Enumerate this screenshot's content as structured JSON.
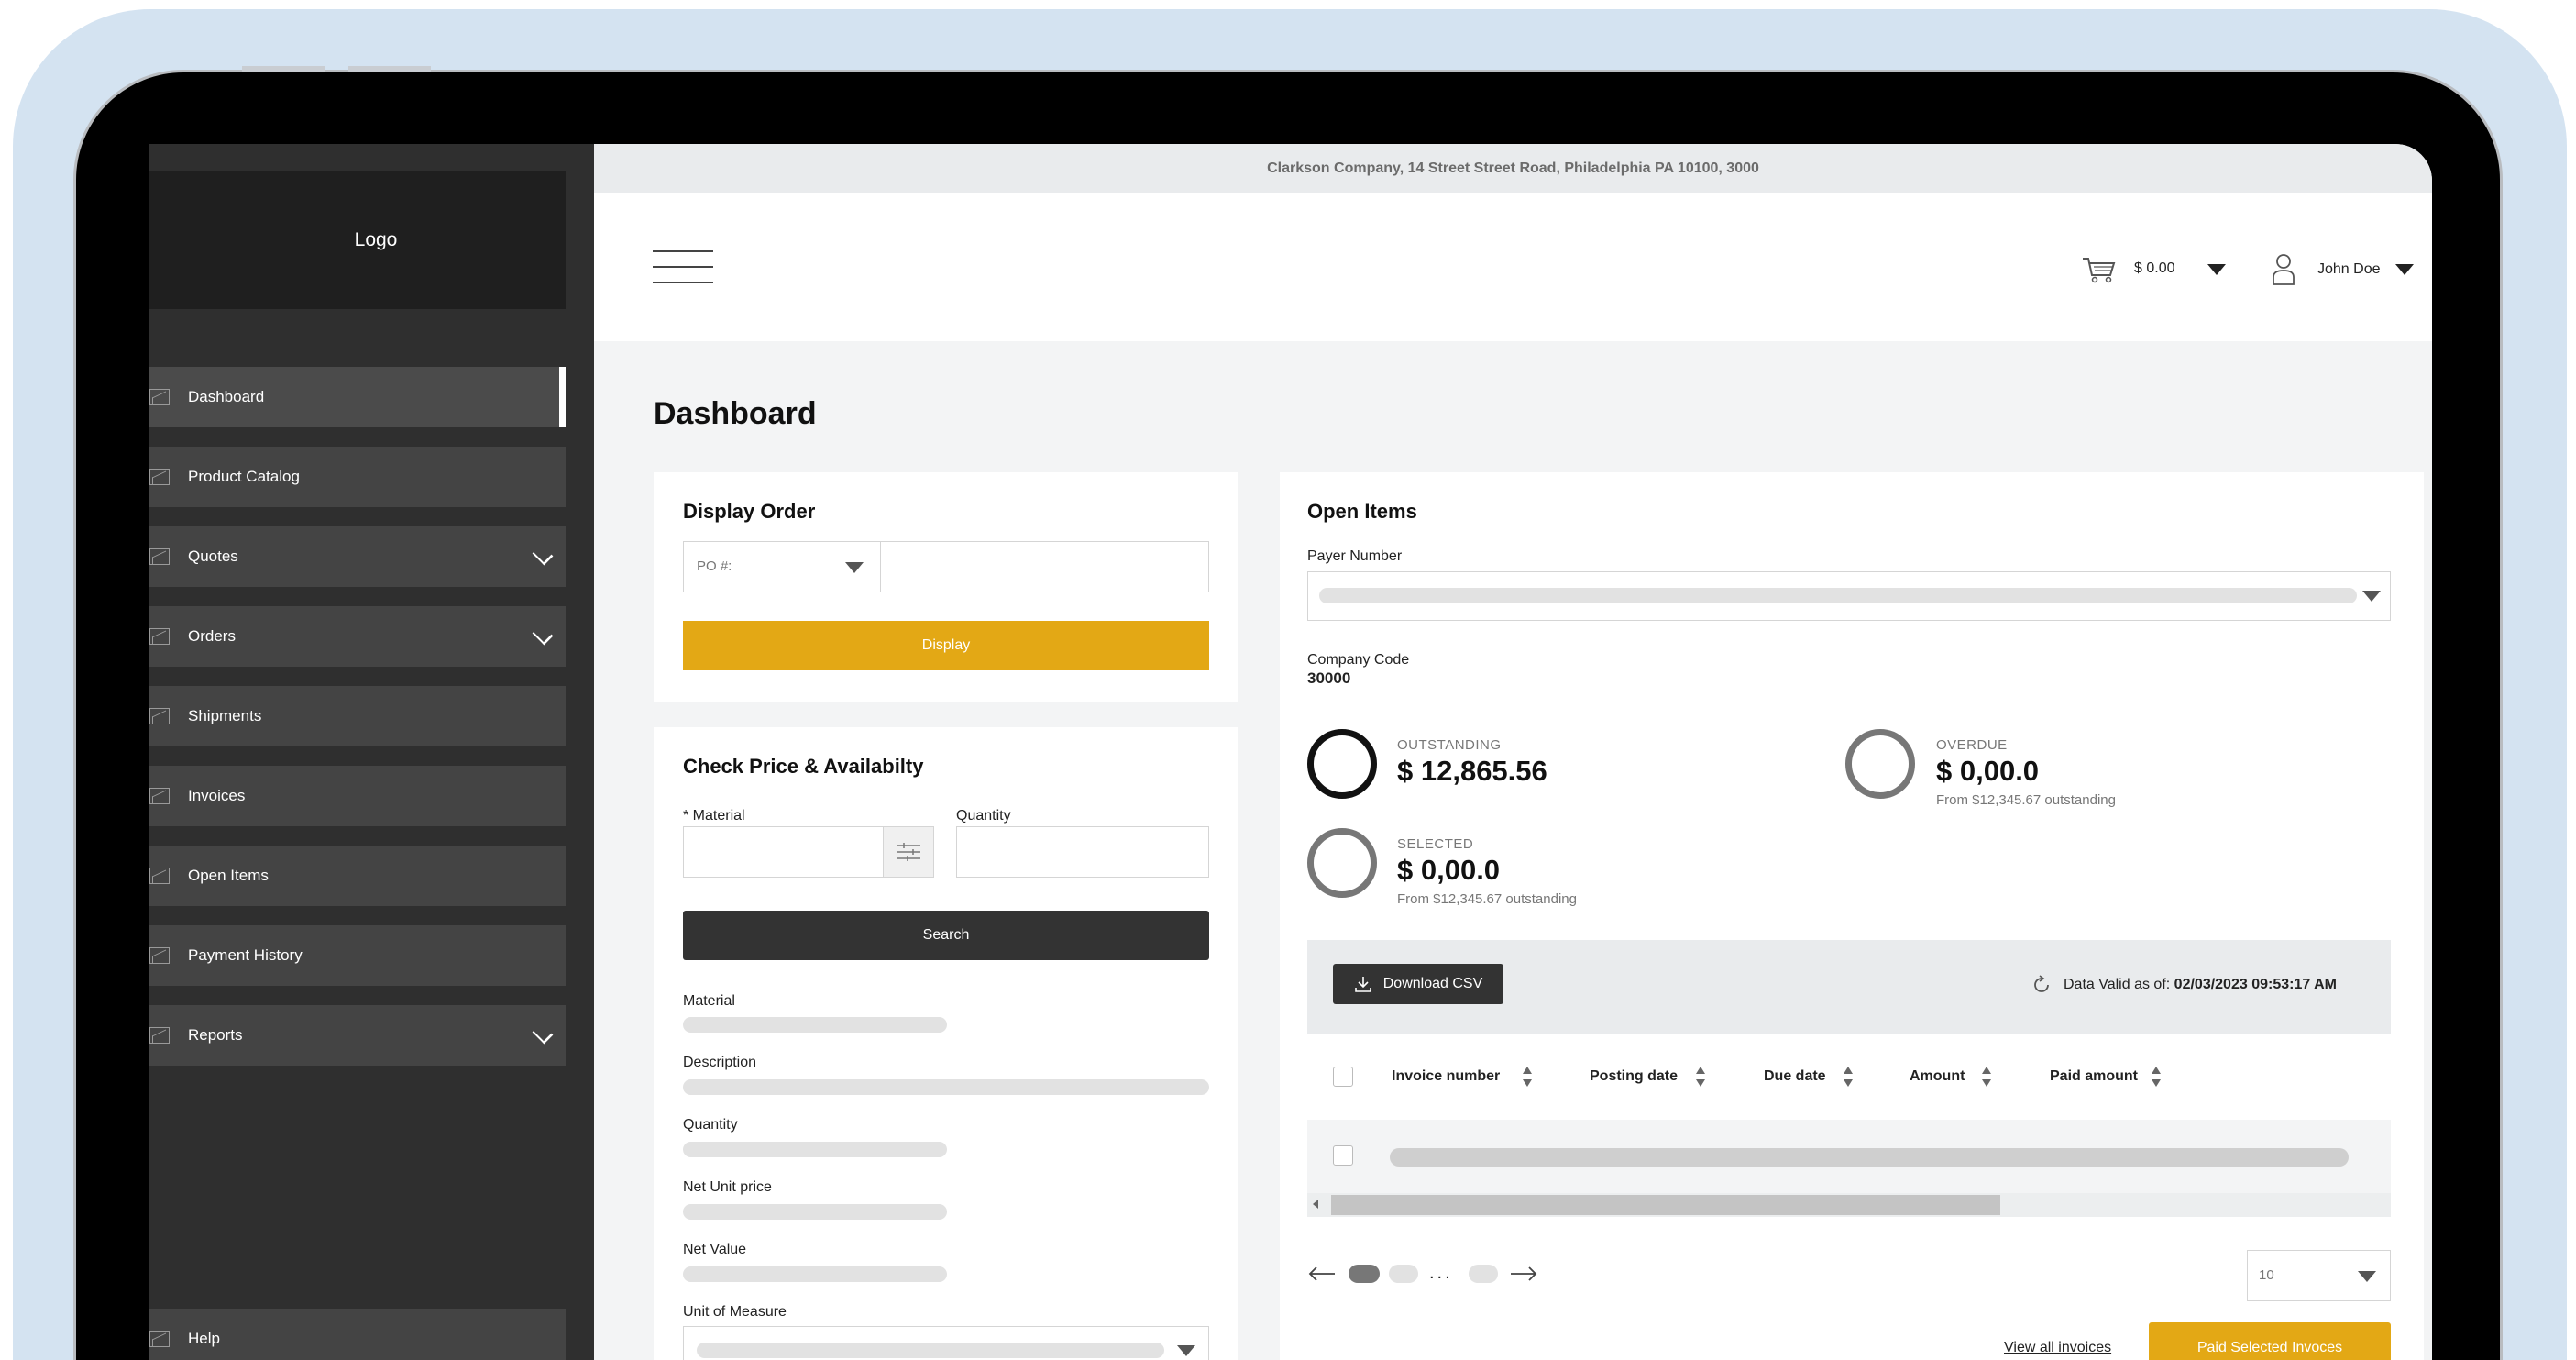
{
  "sidebar": {
    "logo": "Logo",
    "items": [
      {
        "label": "Dashboard",
        "active": true,
        "expandable": false
      },
      {
        "label": "Product Catalog",
        "expandable": false
      },
      {
        "label": "Quotes",
        "expandable": true
      },
      {
        "label": "Orders",
        "expandable": true
      },
      {
        "label": "Shipments",
        "expandable": false
      },
      {
        "label": "Invoices",
        "expandable": false
      },
      {
        "label": "Open Items",
        "expandable": false
      },
      {
        "label": "Payment History",
        "expandable": false
      },
      {
        "label": "Reports",
        "expandable": true
      }
    ],
    "help": "Help"
  },
  "topbar": {
    "address": "Clarkson Company, 14 Street Street Road, Philadelphia PA 10100, 3000"
  },
  "header": {
    "cart_amount": "$ 0.00",
    "user_name": "John Doe"
  },
  "main": {
    "title": "Dashboard"
  },
  "display_order": {
    "title": "Display Order",
    "po_select": "PO #:",
    "po_value": "",
    "display_button": "Display"
  },
  "check_price": {
    "title": "Check Price & Availabilty",
    "material_label": "* Material",
    "quantity_label": "Quantity",
    "search_button": "Search",
    "results": {
      "material": "Material",
      "description": "Description",
      "quantity": "Quantity",
      "net_unit_price": "Net Unit price",
      "net_value": "Net Value",
      "unit_of_measure": "Unit of Measure"
    }
  },
  "open_items": {
    "title": "Open Items",
    "payer_label": "Payer Number",
    "company_code_label": "Company Code",
    "company_code_value": "30000",
    "outstanding": {
      "label": "OUTSTANDING",
      "value": "$ 12,865.56"
    },
    "overdue": {
      "label": "OVERDUE",
      "value": "$ 0,00.0",
      "sub": "From $12,345.67 outstanding"
    },
    "selected": {
      "label": "SELECTED",
      "value": "$ 0,00.0",
      "sub": "From $12,345.67 outstanding"
    },
    "download_button": "Download CSV",
    "data_valid_label": "Data Valid as of:",
    "data_valid_value": "02/03/2023 09:53:17 AM",
    "columns": [
      "Invoice number",
      "Posting date",
      "Due date",
      "Amount",
      "Paid amount"
    ],
    "pagination": {
      "ellipsis": "...",
      "page_size": "10"
    },
    "view_all_link": "View all invoices",
    "paid_button": "Paid Selected Invoces"
  },
  "colors": {
    "accent": "#e3a815",
    "sidebar": "#2f2f2f",
    "nav_item": "#444444"
  }
}
